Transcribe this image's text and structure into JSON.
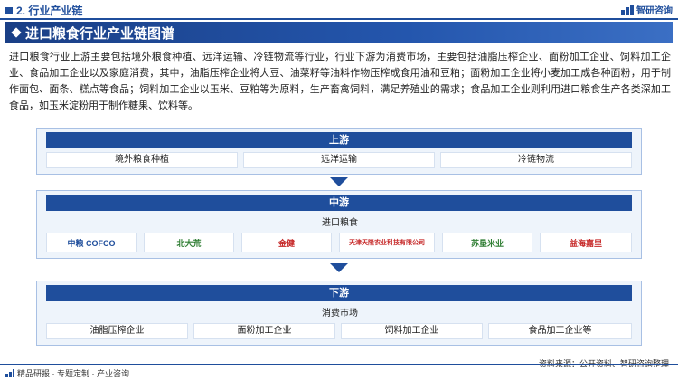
{
  "header": {
    "section_title": "2. 行业产业链",
    "brand": "智研咨询"
  },
  "banner": {
    "title": "进口粮食行业产业链图谱"
  },
  "intro": "进口粮食行业上游主要包括境外粮食种植、远洋运输、冷链物流等行业，行业下游为消费市场，主要包括油脂压榨企业、面粉加工企业、饲料加工企业、食品加工企业以及家庭消费，其中，油脂压榨企业将大豆、油菜籽等油料作物压榨成食用油和豆粕；面粉加工企业将小麦加工成各种面粉，用于制作面包、面条、糕点等食品；饲料加工企业以玉米、豆粕等为原料，生产畜禽饲料，满足养殖业的需求；食品加工企业则利用进口粮食生产各类深加工食品，如玉米淀粉用于制作糖果、饮料等。",
  "upstream": {
    "title": "上游",
    "items": [
      "境外粮食种植",
      "远洋运输",
      "冷链物流"
    ]
  },
  "midstream": {
    "title": "中游",
    "label": "进口粮食",
    "logos": [
      {
        "name": "中粮 COFCO",
        "color": "#1f4e9c"
      },
      {
        "name": "北大荒",
        "color": "#2e7d32"
      },
      {
        "name": "金健",
        "color": "#c62828"
      },
      {
        "name": "天津天隆农业科技有限公司",
        "color": "#c62828"
      },
      {
        "name": "苏垦米业",
        "color": "#2e7d32"
      },
      {
        "name": "益海嘉里",
        "color": "#c62828"
      }
    ]
  },
  "downstream": {
    "title": "下游",
    "label": "消费市场",
    "items": [
      "油脂压榨企业",
      "面粉加工企业",
      "饲料加工企业",
      "食品加工企业等"
    ]
  },
  "footer": {
    "left": "精品研报 · 专题定制 · 产业咨询",
    "source": "资料来源：公开资料、智研咨询整理"
  },
  "colors": {
    "primary": "#1f4e9c",
    "stage_bg": "#eef4fb"
  }
}
